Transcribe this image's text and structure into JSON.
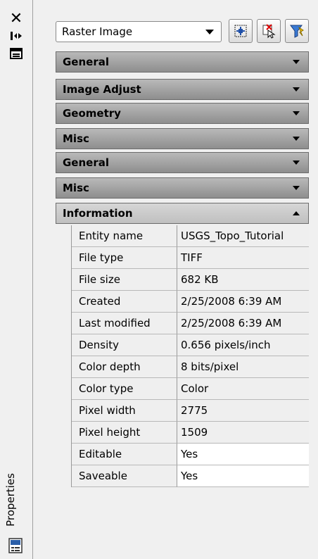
{
  "palette": {
    "header_bg": "#a3a3a3",
    "panel_bg": "#f0f0f0",
    "editable_bg": "#ffffff"
  },
  "strip": {
    "close_icon": "close-icon",
    "autohide_icon": "auto-hide-icon",
    "menu_icon": "properties-menu-icon",
    "title": "Properties"
  },
  "toolbar": {
    "selected_object": "Raster Image",
    "buttons": [
      "toggle-pickadd-icon",
      "select-objects-icon",
      "quick-select-icon"
    ]
  },
  "sections": [
    {
      "label": "General",
      "expanded": false
    },
    {
      "label": "Image Adjust",
      "expanded": false
    },
    {
      "label": "Geometry",
      "expanded": false
    },
    {
      "label": "Misc",
      "expanded": false
    },
    {
      "label": "General",
      "expanded": false
    },
    {
      "label": "Misc",
      "expanded": false
    },
    {
      "label": "Information",
      "expanded": true
    }
  ],
  "info": [
    {
      "key": "Entity name",
      "value": "USGS_Topo_Tutorial"
    },
    {
      "key": "File type",
      "value": "TIFF"
    },
    {
      "key": "File size",
      "value": "682 KB"
    },
    {
      "key": "Created",
      "value": "2/25/2008 6:39 AM"
    },
    {
      "key": "Last modified",
      "value": "2/25/2008 6:39 AM"
    },
    {
      "key": "Density",
      "value": "0.656 pixels/inch"
    },
    {
      "key": "Color depth",
      "value": "8 bits/pixel"
    },
    {
      "key": "Color type",
      "value": "Color"
    },
    {
      "key": "Pixel width",
      "value": "2775"
    },
    {
      "key": "Pixel height",
      "value": "1509"
    },
    {
      "key": "Editable",
      "value": "Yes"
    },
    {
      "key": "Saveable",
      "value": "Yes"
    }
  ]
}
